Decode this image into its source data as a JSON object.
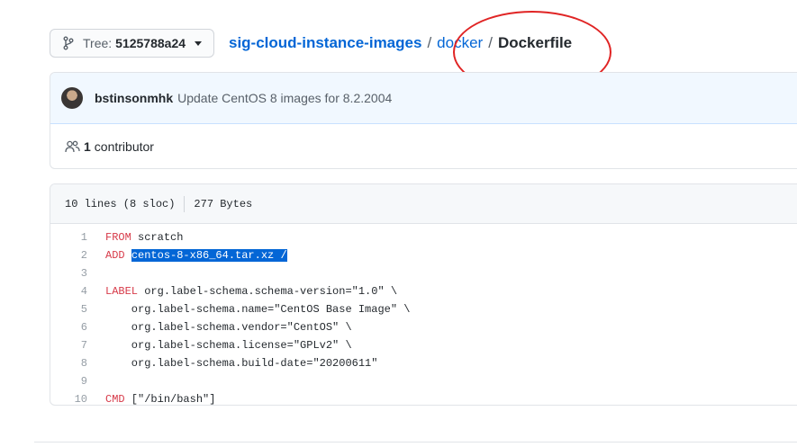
{
  "branch": {
    "label": "Tree:",
    "sha": "5125788a24"
  },
  "breadcrumb": {
    "repo": "sig-cloud-instance-images",
    "sep1": "/",
    "folder": "docker",
    "sep2": "/",
    "file": "Dockerfile"
  },
  "commit": {
    "author": "bstinsonmhk",
    "message": "Update CentOS 8 images for 8.2.2004"
  },
  "contributors": {
    "count": "1",
    "label": "contributor"
  },
  "file_info": {
    "lines": "10 lines (8 sloc)",
    "size": "277 Bytes"
  },
  "code": {
    "line_numbers": [
      "1",
      "2",
      "3",
      "4",
      "5",
      "6",
      "7",
      "8",
      "9",
      "10"
    ],
    "l1_kw": "FROM",
    "l1_rest": " scratch",
    "l2_kw": "ADD",
    "l2_sel": "centos-8-x86_64.tar.xz /",
    "l4_kw": "LABEL",
    "l4_rest": " org.label-schema.schema-version=\"1.0\" \\",
    "l5": "    org.label-schema.name=\"CentOS Base Image\" \\",
    "l6": "    org.label-schema.vendor=\"CentOS\" \\",
    "l7": "    org.label-schema.license=\"GPLv2\" \\",
    "l8": "    org.label-schema.build-date=\"20200611\"",
    "l10_kw": "CMD",
    "l10_rest": " [\"/bin/bash\"]"
  },
  "colors": {
    "link": "#0366d6",
    "keyword": "#d73a49",
    "selection": "#0366d6",
    "annotation": "#e02424"
  },
  "icons": {
    "branch": "git-branch-icon",
    "caret": "caret-down-icon",
    "contributors": "people-icon"
  }
}
